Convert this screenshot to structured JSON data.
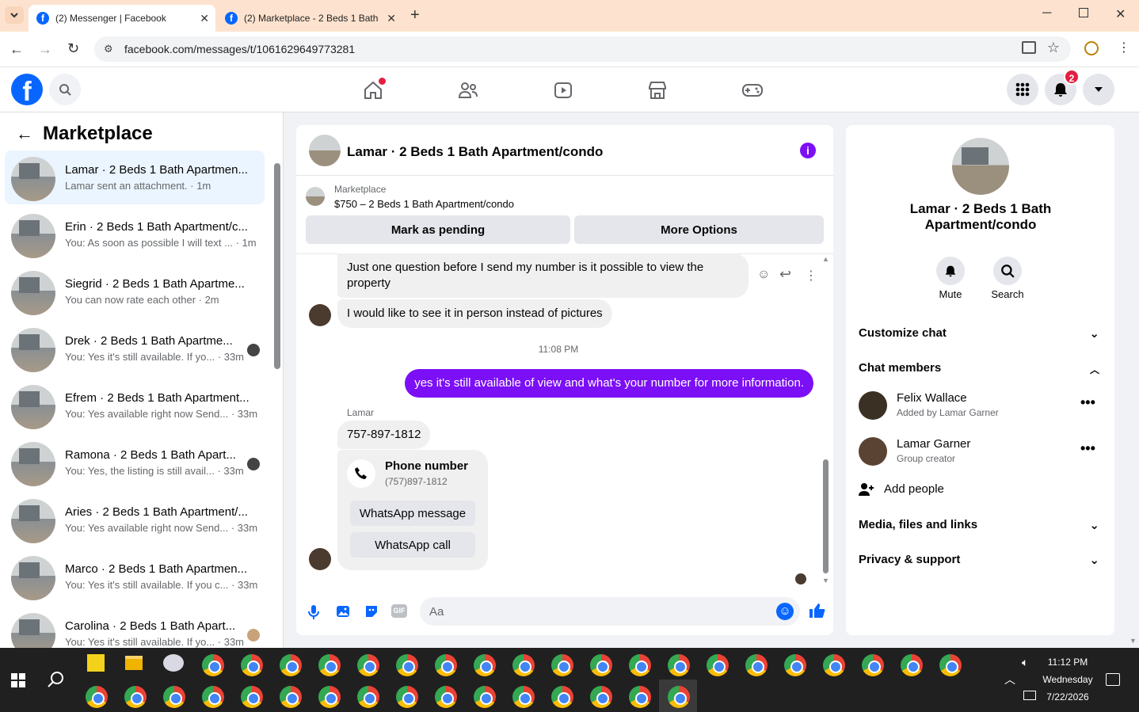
{
  "browser": {
    "tabs": [
      {
        "title": "(2) Messenger | Facebook"
      },
      {
        "title": "(2) Marketplace - 2 Beds 1 Bath"
      }
    ],
    "url": "facebook.com/messages/t/1061629649773281"
  },
  "fbnav": {
    "notif_count": "2"
  },
  "sidebar": {
    "title": "Marketplace",
    "conversations": [
      {
        "name": "Lamar · 2 Beds 1 Bath Apartmen...",
        "preview": "Lamar sent an attachment. · 1m"
      },
      {
        "name": "Erin · 2 Beds 1 Bath Apartment/c...",
        "preview": "You: As soon as possible I will text ... · 1m"
      },
      {
        "name": "Siegrid · 2 Beds 1 Bath Apartme...",
        "preview": "You can now rate each other · 2m"
      },
      {
        "name": "Drek · 2 Beds 1 Bath Apartme...",
        "preview": "You: Yes it's still available. If yo... · 33m"
      },
      {
        "name": "Efrem · 2 Beds 1 Bath Apartment...",
        "preview": "You: Yes available right now Send... · 33m"
      },
      {
        "name": "Ramona · 2 Beds 1 Bath Apart...",
        "preview": "You: Yes, the listing is still avail... · 33m"
      },
      {
        "name": "Aries · 2 Beds 1 Bath Apartment/...",
        "preview": "You: Yes available right now Send... · 33m"
      },
      {
        "name": "Marco · 2 Beds 1 Bath Apartmen...",
        "preview": "You: Yes it's still available. If you c... · 33m"
      },
      {
        "name": "Carolina · 2 Beds 1 Bath Apart...",
        "preview": "You: Yes it's still available. If yo... · 33m"
      }
    ]
  },
  "chat": {
    "title": "Lamar · 2 Beds 1 Bath Apartment/condo",
    "listing_source": "Marketplace",
    "listing_price": "$750 – 2 Beds 1 Bath Apartment/condo",
    "mark_pending": "Mark as pending",
    "more_options": "More Options",
    "messages": {
      "m1": "Just one question before I send my number is it possible to view the property",
      "m2": "I would like to see it in person instead of pictures",
      "time": "11:08 PM",
      "m3": "yes it's still available of view and what's your number for more information.",
      "sender": "Lamar",
      "m4": "757-897-1812",
      "card_title": "Phone number",
      "card_number": "(757)897-1812",
      "wa_message": "WhatsApp message",
      "wa_call": "WhatsApp call"
    },
    "composer_placeholder": "Aa",
    "accent": "#7b0ff5"
  },
  "panel": {
    "name": "Lamar · 2 Beds 1 Bath Apartment/condo",
    "mute": "Mute",
    "search": "Search",
    "customize": "Customize chat",
    "members_title": "Chat members",
    "members": [
      {
        "name": "Felix Wallace",
        "sub": "Added by Lamar Garner"
      },
      {
        "name": "Lamar Garner",
        "sub": "Group creator"
      }
    ],
    "add_people": "Add people",
    "media": "Media, files and links",
    "privacy": "Privacy & support"
  },
  "taskbar": {
    "time": "11:12 PM",
    "day": "Wednesday",
    "date": "7/22/2026"
  }
}
